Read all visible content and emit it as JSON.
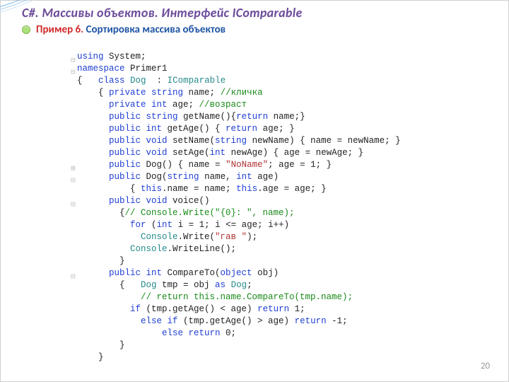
{
  "title": "С#. Массивы объектов. Интерфейс IComparable",
  "bullet": {
    "prefix": "Пример 6. ",
    "rest": "Сортировка массива объектов"
  },
  "pagenum": "20",
  "gutter": "\n⊟\n⊟\n\n\n\n\n\n\n\n⊞\n⊟\n\n⊟\n\n\n\n\n\n⊟\n\n\n\n\n\n\n\n",
  "code_lines": [
    [
      [
        "kw",
        "using"
      ],
      [
        "",
        " System;"
      ]
    ],
    [
      [
        "kw",
        "namespace"
      ],
      [
        "",
        " Primer1"
      ]
    ],
    [
      [
        "",
        "{   "
      ],
      [
        "kw",
        "class"
      ],
      [
        "",
        " "
      ],
      [
        "tp",
        "Dog"
      ],
      [
        "",
        "  : "
      ],
      [
        "tp",
        "IComparable"
      ]
    ],
    [
      [
        "",
        "    { "
      ],
      [
        "kw",
        "private string"
      ],
      [
        "",
        " name; "
      ],
      [
        "cm",
        "//кличка"
      ]
    ],
    [
      [
        "",
        "      "
      ],
      [
        "kw",
        "private int"
      ],
      [
        "",
        " age; "
      ],
      [
        "cm",
        "//возраст"
      ]
    ],
    [
      [
        "",
        "      "
      ],
      [
        "kw",
        "public string"
      ],
      [
        "",
        " getName(){"
      ],
      [
        "kw",
        "return"
      ],
      [
        "",
        " name;}"
      ]
    ],
    [
      [
        "",
        "      "
      ],
      [
        "kw",
        "public int"
      ],
      [
        "",
        " getAge() { "
      ],
      [
        "kw",
        "return"
      ],
      [
        "",
        " age; }"
      ]
    ],
    [
      [
        "",
        "      "
      ],
      [
        "kw",
        "public void"
      ],
      [
        "",
        " setName("
      ],
      [
        "kw",
        "string"
      ],
      [
        "",
        " newName) { name = newName; }"
      ]
    ],
    [
      [
        "",
        "      "
      ],
      [
        "kw",
        "public void"
      ],
      [
        "",
        " setAge("
      ],
      [
        "kw",
        "int"
      ],
      [
        "",
        " newAge) { age = newAge; }"
      ]
    ],
    [
      [
        "",
        "      "
      ],
      [
        "kw",
        "public"
      ],
      [
        "",
        " Dog() { name = "
      ],
      [
        "st",
        "\"NoName\""
      ],
      [
        "",
        "; age = 1; }"
      ]
    ],
    [
      [
        "",
        "      "
      ],
      [
        "kw",
        "public"
      ],
      [
        "",
        " Dog("
      ],
      [
        "kw",
        "string"
      ],
      [
        "",
        " name, "
      ],
      [
        "kw",
        "int"
      ],
      [
        "",
        " age)"
      ]
    ],
    [
      [
        "",
        "          { "
      ],
      [
        "kw",
        "this"
      ],
      [
        "",
        ".name = name; "
      ],
      [
        "kw",
        "this"
      ],
      [
        "",
        ".age = age; }"
      ]
    ],
    [
      [
        "",
        "      "
      ],
      [
        "kw",
        "public void"
      ],
      [
        "",
        " voice()"
      ]
    ],
    [
      [
        "",
        "        {"
      ],
      [
        "cm",
        "// Console.Write(\"{0}: \", name);"
      ]
    ],
    [
      [
        "",
        "          "
      ],
      [
        "kw",
        "for"
      ],
      [
        "",
        " ("
      ],
      [
        "kw",
        "int"
      ],
      [
        "",
        " i = 1; i <= age; i++)"
      ]
    ],
    [
      [
        "",
        "            "
      ],
      [
        "tp",
        "Console"
      ],
      [
        "",
        ".Write("
      ],
      [
        "st",
        "\"гав \""
      ],
      [
        "",
        ");"
      ]
    ],
    [
      [
        "",
        "          "
      ],
      [
        "tp",
        "Console"
      ],
      [
        "",
        ".WriteLine();"
      ]
    ],
    [
      [
        "",
        "        }"
      ]
    ],
    [
      [
        "",
        "      "
      ],
      [
        "kw",
        "public int"
      ],
      [
        "",
        " CompareTo("
      ],
      [
        "kw",
        "object"
      ],
      [
        "",
        " obj)"
      ]
    ],
    [
      [
        "",
        "        {   "
      ],
      [
        "tp",
        "Dog"
      ],
      [
        "",
        " tmp = obj "
      ],
      [
        "kw",
        "as"
      ],
      [
        "",
        " "
      ],
      [
        "tp",
        "Dog"
      ],
      [
        "",
        ";"
      ]
    ],
    [
      [
        "",
        "            "
      ],
      [
        "cm",
        "// return this.name.CompareTo(tmp.name);"
      ]
    ],
    [
      [
        "",
        "          "
      ],
      [
        "kw",
        "if"
      ],
      [
        "",
        " (tmp.getAge() < age) "
      ],
      [
        "kw",
        "return"
      ],
      [
        "",
        " 1;"
      ]
    ],
    [
      [
        "",
        "            "
      ],
      [
        "kw",
        "else if"
      ],
      [
        "",
        " (tmp.getAge() > age) "
      ],
      [
        "kw",
        "return"
      ],
      [
        "",
        " -1;"
      ]
    ],
    [
      [
        "",
        "                "
      ],
      [
        "kw",
        "else return"
      ],
      [
        "",
        " 0;"
      ]
    ],
    [
      [
        "",
        "        }"
      ]
    ],
    [
      [
        "",
        "    }"
      ]
    ]
  ]
}
